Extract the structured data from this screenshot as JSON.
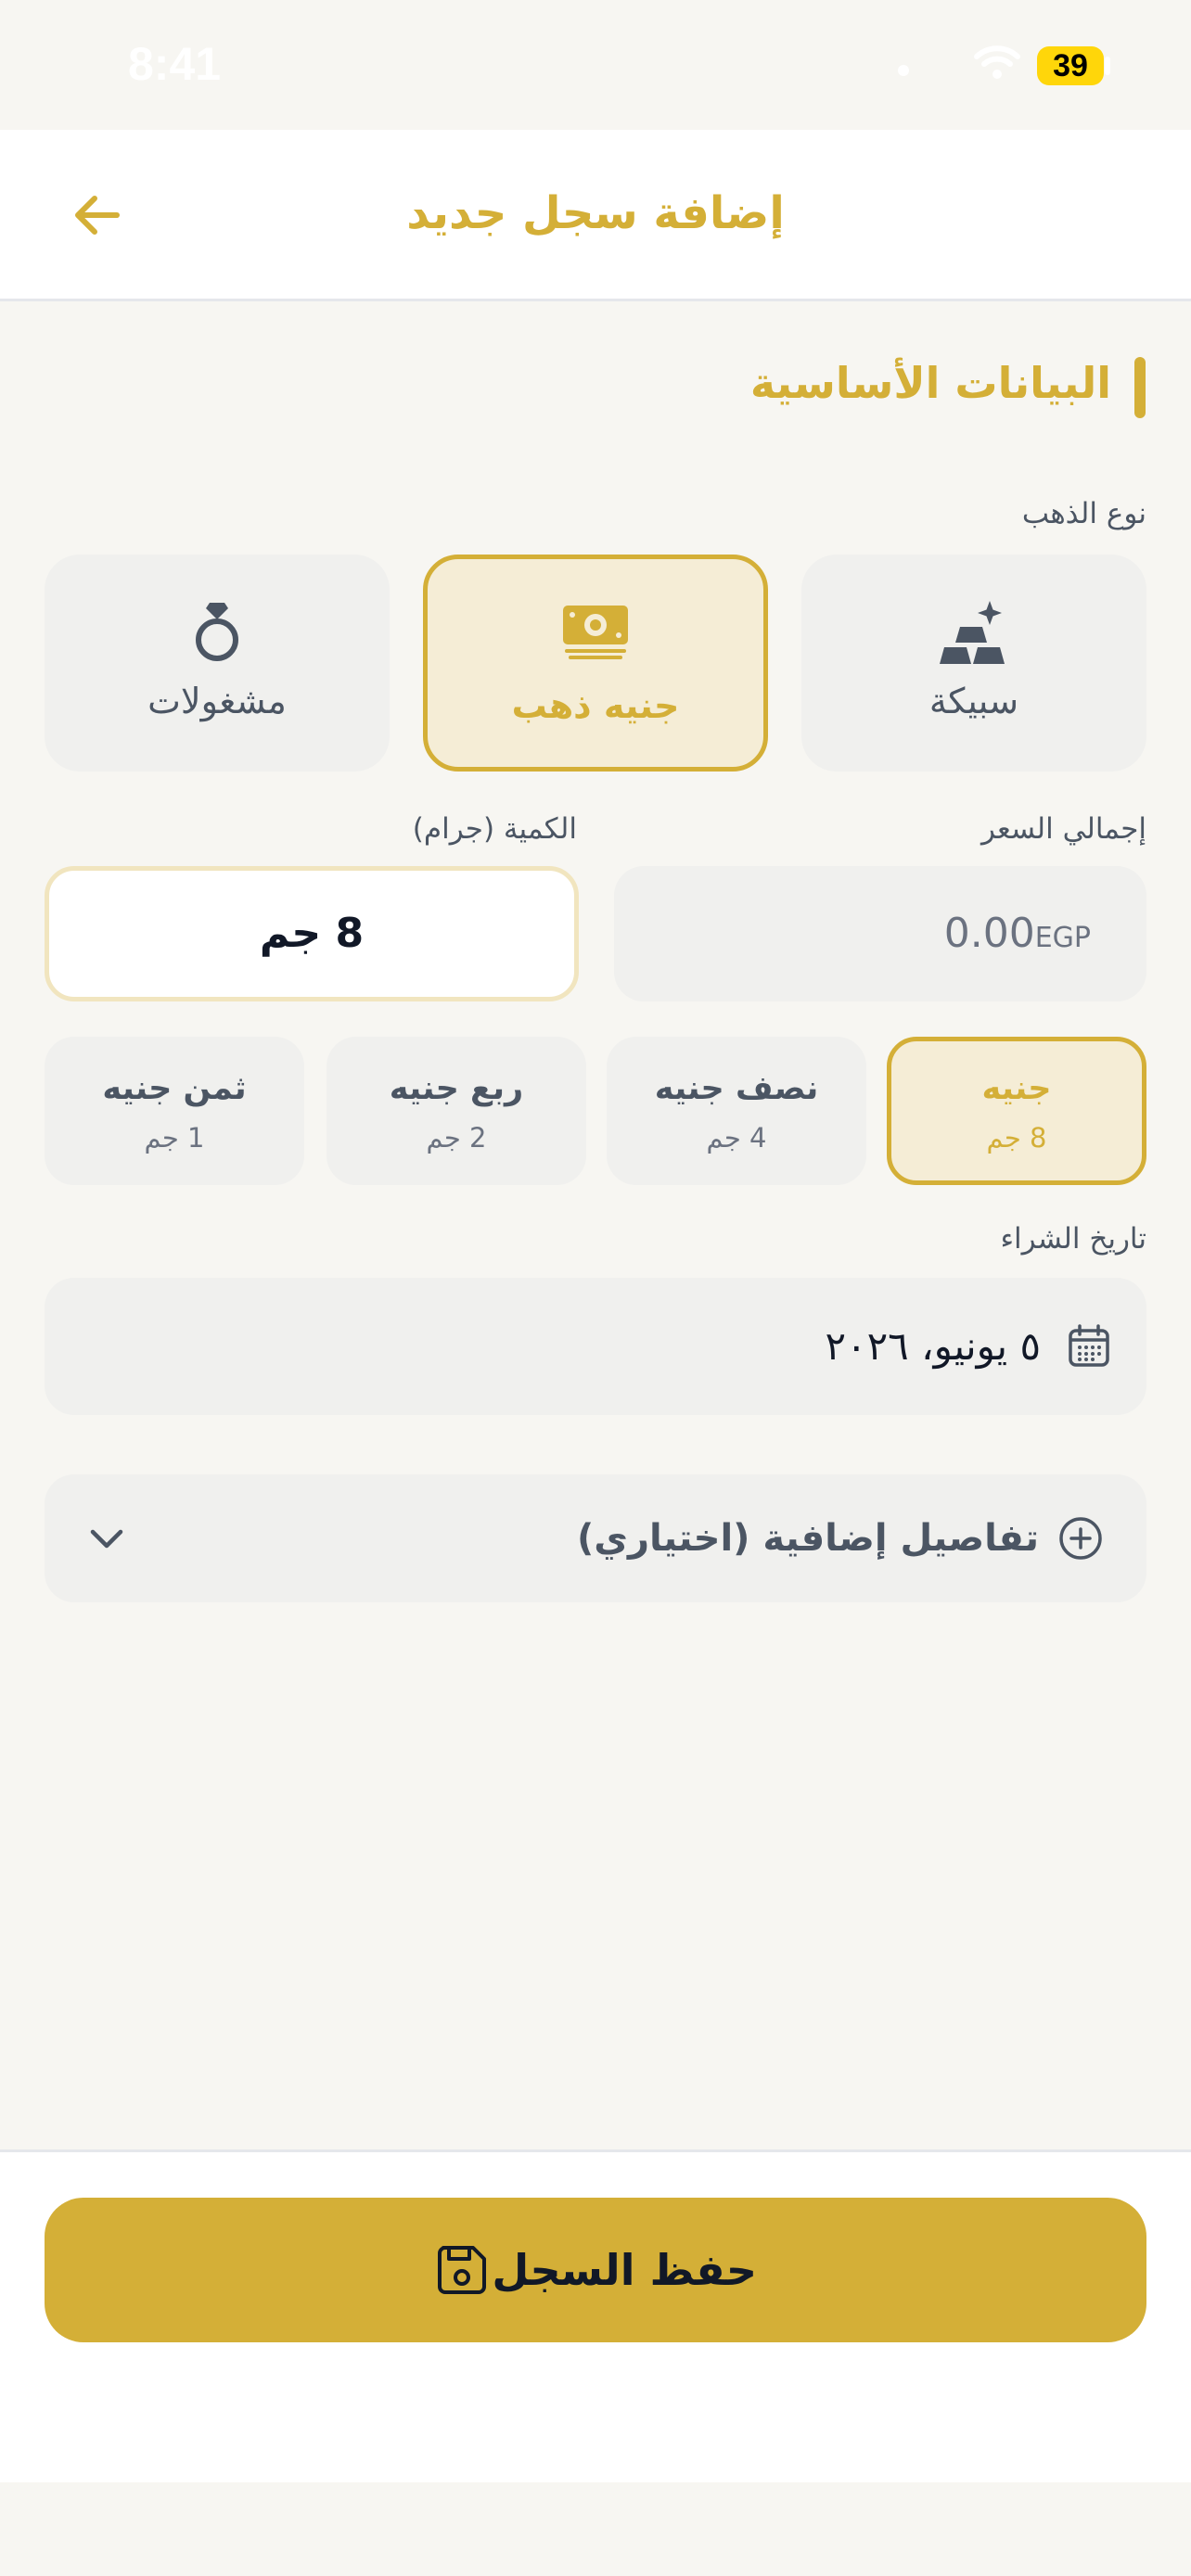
{
  "status_bar": {
    "time": "8:41",
    "battery": "39"
  },
  "header": {
    "title": "إضافة سجل جديد"
  },
  "section": {
    "title": "البيانات الأساسية"
  },
  "gold_type": {
    "label": "نوع الذهب",
    "options": [
      {
        "label": "سبيكة",
        "icon": "gold-bars-icon",
        "selected": false
      },
      {
        "label": "جنيه ذهب",
        "icon": "money-coin-icon",
        "selected": true
      },
      {
        "label": "مشغولات",
        "icon": "ring-icon",
        "selected": false
      }
    ]
  },
  "price": {
    "label": "إجمالي السعر",
    "placeholder": "0.00",
    "currency": "EGP"
  },
  "quantity": {
    "label": "الكمية (جرام)",
    "value": "8 جم"
  },
  "coin_sizes": [
    {
      "name": "جنيه",
      "weight": "8 جم",
      "selected": true
    },
    {
      "name": "نصف جنيه",
      "weight": "4 جم",
      "selected": false
    },
    {
      "name": "ربع جنيه",
      "weight": "2 جم",
      "selected": false
    },
    {
      "name": "ثمن جنيه",
      "weight": "1 جم",
      "selected": false
    }
  ],
  "purchase_date": {
    "label": "تاريخ الشراء",
    "value": "٥ يونيو، ٢٠٢٦"
  },
  "extra_details": {
    "label": "تفاصيل إضافية (اختياري)"
  },
  "save": {
    "label": "حفظ السجل"
  },
  "colors": {
    "accent": "#D4AF37",
    "accent_light": "#F5EDD6",
    "background": "#F7F6F2",
    "field": "#F0F0EE"
  }
}
